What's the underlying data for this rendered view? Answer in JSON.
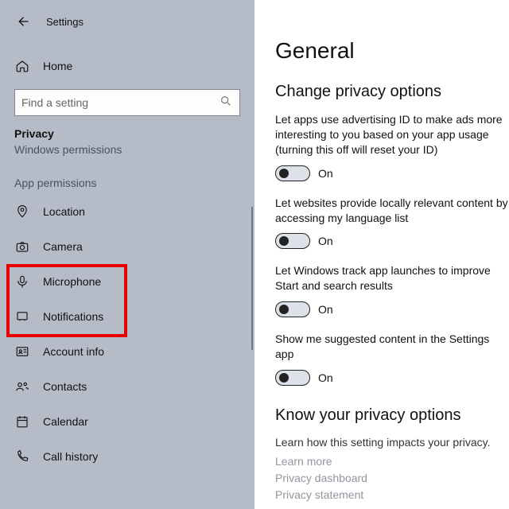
{
  "header": {
    "title": "Settings"
  },
  "sidebar": {
    "home": "Home",
    "search_placeholder": "Find a setting",
    "category": "Privacy",
    "subcategory": "Windows permissions",
    "group": "App permissions",
    "items": [
      {
        "label": "Location"
      },
      {
        "label": "Camera"
      },
      {
        "label": "Microphone"
      },
      {
        "label": "Notifications"
      },
      {
        "label": "Account info"
      },
      {
        "label": "Contacts"
      },
      {
        "label": "Calendar"
      },
      {
        "label": "Call history"
      }
    ]
  },
  "main": {
    "title": "General",
    "section": "Change privacy options",
    "opts": [
      {
        "desc": "Let apps use advertising ID to make ads more interesting to you based on your app usage (turning this off will reset your ID)",
        "state": "On"
      },
      {
        "desc": "Let websites provide locally relevant content by accessing my language list",
        "state": "On"
      },
      {
        "desc": "Let Windows track app launches to improve Start and search results",
        "state": "On"
      },
      {
        "desc": "Show me suggested content in the Settings app",
        "state": "On"
      }
    ],
    "know_title": "Know your privacy options",
    "know_sub": "Learn how this setting impacts your privacy.",
    "links": [
      "Learn more",
      "Privacy dashboard",
      "Privacy statement"
    ]
  }
}
